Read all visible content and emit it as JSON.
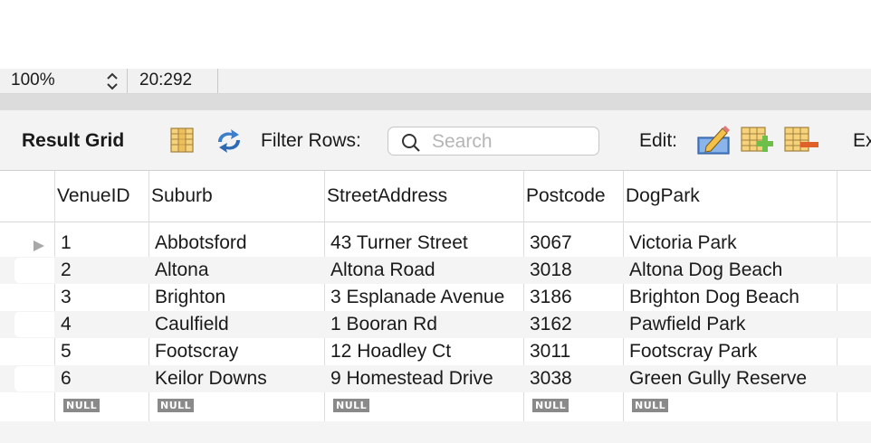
{
  "status_bar": {
    "zoom": "100%",
    "cursor_position": "20:292"
  },
  "toolbar": {
    "result_grid_label": "Result Grid",
    "filter_rows_label": "Filter Rows:",
    "search_placeholder": "Search",
    "edit_label": "Edit:",
    "export_label": "Ex"
  },
  "icons": {
    "grid": "result-grid-icon",
    "refresh": "refresh-icon",
    "search": "search-icon",
    "edit_row": "edit-row-icon",
    "add_row": "add-row-icon",
    "delete_row": "delete-row-icon",
    "row_pointer": "row-pointer-icon",
    "stepper": "zoom-stepper-icon"
  },
  "grid": {
    "columns": [
      "VenueID",
      "Suburb",
      "StreetAddress",
      "Postcode",
      "DogPark"
    ],
    "rows": [
      [
        "1",
        "Abbotsford",
        "43 Turner Street",
        "3067",
        "Victoria Park"
      ],
      [
        "2",
        "Altona",
        "Altona Road",
        "3018",
        "Altona Dog Beach"
      ],
      [
        "3",
        "Brighton",
        "3 Esplanade Avenue",
        "3186",
        "Brighton Dog Beach"
      ],
      [
        "4",
        "Caulfield",
        "1 Booran Rd",
        "3162",
        "Pawfield Park"
      ],
      [
        "5",
        "Footscray",
        "12 Hoadley Ct",
        "3011",
        "Footscray Park"
      ],
      [
        "6",
        "Keilor Downs",
        "9 Homestead Drive",
        "3038",
        "Green Gully Reserve"
      ]
    ],
    "null_label": "NULL"
  }
}
